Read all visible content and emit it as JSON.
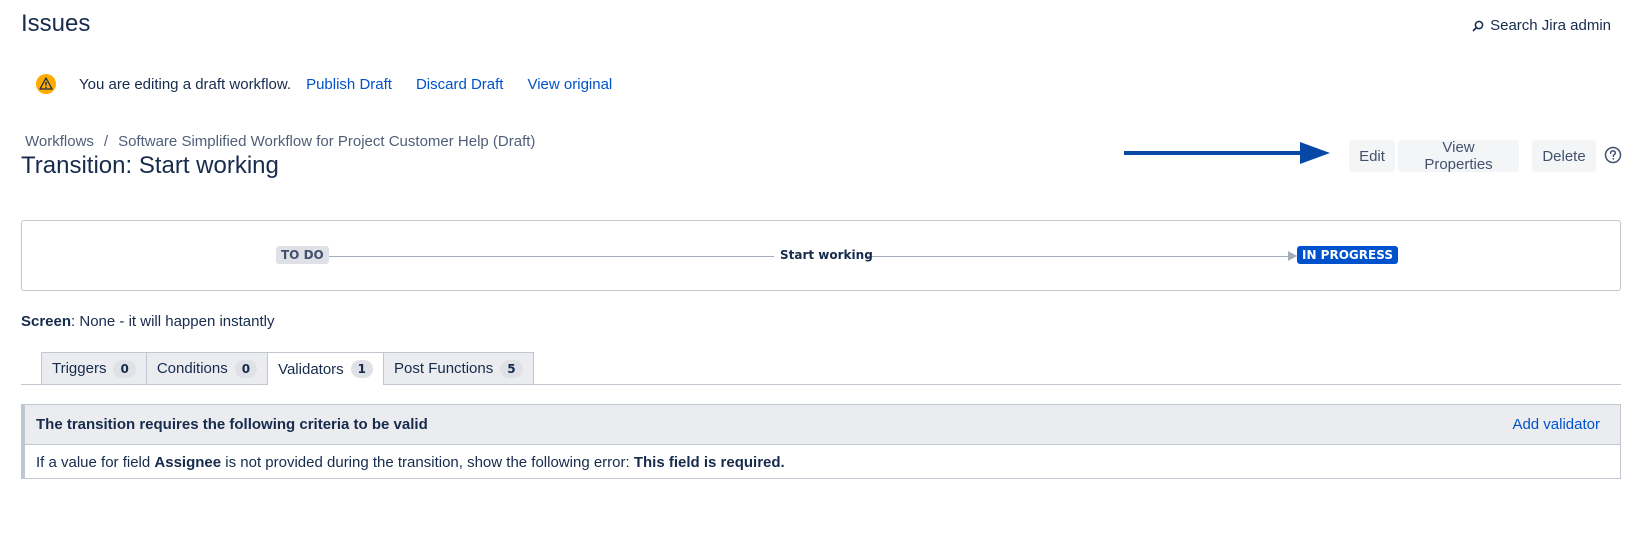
{
  "header": {
    "title": "Issues",
    "search_label": "Search Jira admin"
  },
  "draft_bar": {
    "message": "You are editing a draft workflow.",
    "publish_label": "Publish Draft",
    "discard_label": "Discard Draft",
    "view_original_label": "View original"
  },
  "breadcrumb": {
    "root": "Workflows",
    "separator": "/",
    "current": "Software Simplified Workflow for Project Customer Help (Draft)"
  },
  "transition": {
    "title": "Transition: Start working",
    "name": "Start working",
    "from_status": "TO DO",
    "to_status": "IN PROGRESS"
  },
  "actions": {
    "edit_label": "Edit",
    "view_properties_label": "View Properties",
    "delete_label": "Delete"
  },
  "screen": {
    "label": "Screen",
    "value": ": None - it will happen instantly"
  },
  "tabs": [
    {
      "label": "Triggers",
      "count": "0",
      "active": false
    },
    {
      "label": "Conditions",
      "count": "0",
      "active": false
    },
    {
      "label": "Validators",
      "count": "1",
      "active": true
    },
    {
      "label": "Post Functions",
      "count": "5",
      "active": false
    }
  ],
  "validators": {
    "header": "The transition requires the following criteria to be valid",
    "add_label": "Add validator",
    "rule": {
      "prefix": "If a value for field ",
      "field": "Assignee",
      "middle": " is not provided during the transition, show the following error: ",
      "error": "This field is required."
    }
  },
  "colors": {
    "link": "#0052cc",
    "in_progress": "#0052cc",
    "todo": "#dfe1e6",
    "warning": "#ffab00",
    "arrow": "#0747a6"
  }
}
